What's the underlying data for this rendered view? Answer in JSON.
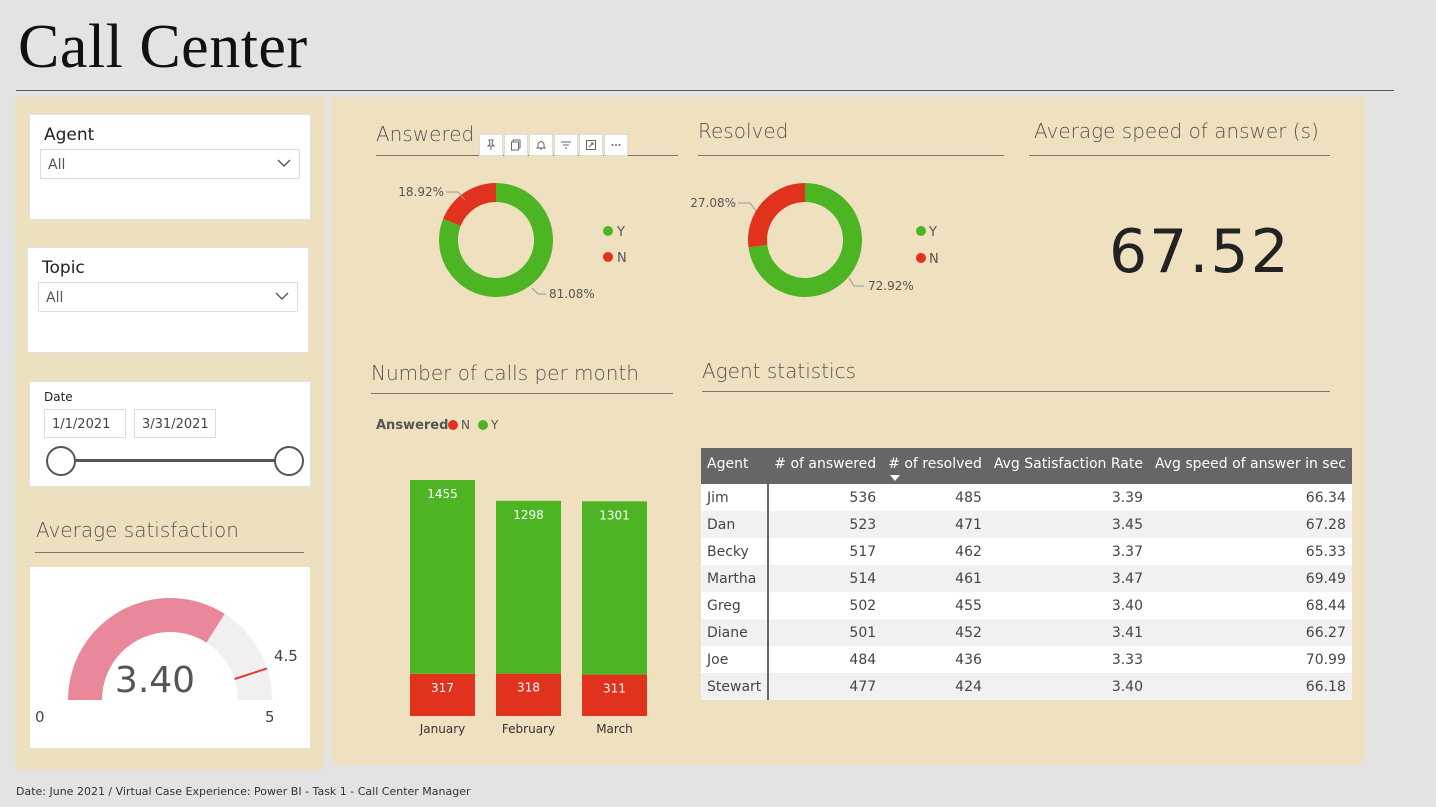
{
  "page_title": "Call Center",
  "filters": {
    "agent": {
      "label": "Agent",
      "value": "All"
    },
    "topic": {
      "label": "Topic",
      "value": "All"
    },
    "date": {
      "label": "Date",
      "start": "1/1/2021",
      "end": "3/31/2021"
    }
  },
  "satisfaction": {
    "title": "Average satisfaction",
    "value_label": "3.40",
    "value": 3.4,
    "min_label": "0",
    "max_label": "5",
    "target_label": "4.5",
    "min": 0,
    "max": 5,
    "target": 4.5,
    "colors": {
      "fill": "#e8889a",
      "track": "#f1efef",
      "target": "#e03a3a"
    }
  },
  "answered": {
    "title": "Answered",
    "y_label": "81.08%",
    "n_label": "18.92%",
    "y_pct": 81.08,
    "n_pct": 18.92,
    "legend": [
      "Y",
      "N"
    ]
  },
  "resolved": {
    "title": "Resolved",
    "y_label": "72.92%",
    "n_label": "27.08%",
    "y_pct": 72.92,
    "n_pct": 27.08,
    "legend": [
      "Y",
      "N"
    ]
  },
  "colors": {
    "yes": "#4db524",
    "no": "#e1321e"
  },
  "speed": {
    "title": "Average speed of answer (s)",
    "value": "67.52"
  },
  "toolbar_icons": [
    "pin-icon",
    "copy-icon",
    "bell-icon",
    "filter-icon",
    "focus-icon",
    "more-icon"
  ],
  "calls_chart_title": "Number of calls per month",
  "chart_data": {
    "type": "bar",
    "stacked": true,
    "legend_title": "Answered",
    "categories": [
      "January",
      "February",
      "March"
    ],
    "series": [
      {
        "name": "N",
        "values": [
          317,
          318,
          311
        ]
      },
      {
        "name": "Y",
        "values": [
          1455,
          1298,
          1301
        ]
      }
    ],
    "legend_labels": [
      "N",
      "Y"
    ]
  },
  "agent_stats": {
    "title": "Agent statistics",
    "columns": [
      "Agent",
      "# of answered",
      "# of resolved",
      "Avg Satisfaction Rate",
      "Avg speed of answer in sec"
    ],
    "rows": [
      [
        "Jim",
        "536",
        "485",
        "3.39",
        "66.34"
      ],
      [
        "Dan",
        "523",
        "471",
        "3.45",
        "67.28"
      ],
      [
        "Becky",
        "517",
        "462",
        "3.37",
        "65.33"
      ],
      [
        "Martha",
        "514",
        "461",
        "3.47",
        "69.49"
      ],
      [
        "Greg",
        "502",
        "455",
        "3.40",
        "68.44"
      ],
      [
        "Diane",
        "501",
        "452",
        "3.41",
        "66.27"
      ],
      [
        "Joe",
        "484",
        "436",
        "3.33",
        "70.99"
      ],
      [
        "Stewart",
        "477",
        "424",
        "3.40",
        "66.18"
      ]
    ]
  },
  "footer": "Date: June 2021 / Virtual Case Experience: Power BI - Task 1 - Call Center Manager"
}
